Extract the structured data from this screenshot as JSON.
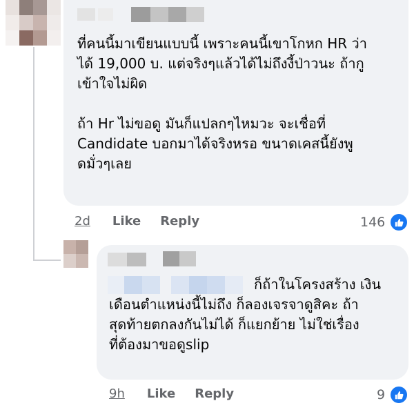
{
  "comment": {
    "text": "ที่คนนี้มาเขียนแบบนี้ เพราะคนนี้เขาโกหก HR ว่า\nได้ 19,000 บ. แต่จริงๆแล้วได้ไม่ถึงงี้ป่าวนะ ถ้ากู\nเข้าใจไม่ผิด\n\nถ้า Hr ไม่ขอดู มันก็แปลกๆไหมวะ จะเชื่อที่\nCandidate บอกมาได้จริงหรอ ขนาดเคสนี้ยังพู\nดมั่วๆเลย",
    "time": "2d",
    "like_label": "Like",
    "reply_label": "Reply",
    "reaction_count": "146",
    "reaction_icon": "like-icon"
  },
  "reply": {
    "text_first": "ก็ถ้าในโครงสร้าง เงิน",
    "text_rest": "เดือนตำแหน่งนี้ไม่ถึง ก็ลองเจรจาดูสิคะ ถ้า\nสุดท้ายตกลงกันไม่ได้ ก็แยกย้าย ไม่ใช่เรื่อง\nที่ต้องมาขอดูslip",
    "time": "9h",
    "like_label": "Like",
    "reply_label": "Reply",
    "reaction_count": "9",
    "reaction_icon": "like-icon"
  },
  "colors": {
    "bubble": "#f0f2f5",
    "meta": "#65676b",
    "like_blue": "#1877f2"
  }
}
